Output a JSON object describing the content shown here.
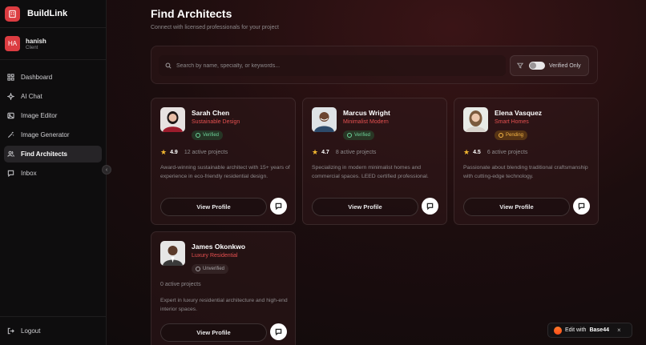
{
  "app": {
    "name": "BuildLink"
  },
  "user": {
    "initials": "HA",
    "name": "hanish",
    "role": "Client"
  },
  "nav": [
    {
      "label": "Dashboard",
      "icon": "grid-icon",
      "active": false
    },
    {
      "label": "AI Chat",
      "icon": "sparkle-icon",
      "active": false
    },
    {
      "label": "Image Editor",
      "icon": "image-icon",
      "active": false
    },
    {
      "label": "Image Generator",
      "icon": "wand-icon",
      "active": false
    },
    {
      "label": "Find Architects",
      "icon": "users-icon",
      "active": true
    },
    {
      "label": "Inbox",
      "icon": "message-icon",
      "active": false
    }
  ],
  "logout": {
    "label": "Logout"
  },
  "page": {
    "title": "Find Architects",
    "subtitle": "Connect with licensed professionals for your project"
  },
  "search": {
    "placeholder": "Search by name, specialty, or keywords...",
    "value": ""
  },
  "filter": {
    "label": "Verified Only",
    "enabled": false
  },
  "architects": [
    {
      "name": "Sarah Chen",
      "specialty": "Sustainable Design",
      "status": "Verified",
      "rating": "4.9",
      "projects": "12 active projects",
      "bio": "Award-winning sustainable architect with 15+ years of experience in eco-friendly residential design.",
      "view_label": "View Profile"
    },
    {
      "name": "Marcus Wright",
      "specialty": "Minimalist Modern",
      "status": "Verified",
      "rating": "4.7",
      "projects": "8 active projects",
      "bio": "Specializing in modern minimalist homes and commercial spaces. LEED certified professional.",
      "view_label": "View Profile"
    },
    {
      "name": "Elena Vasquez",
      "specialty": "Smart Homes",
      "status": "Pending",
      "rating": "4.5",
      "projects": "6 active projects",
      "bio": "Passionate about blending traditional craftsmanship with cutting-edge technology.",
      "view_label": "View Profile"
    },
    {
      "name": "James Okonkwo",
      "specialty": "Luxury Residential",
      "status": "Unverified",
      "rating": "",
      "projects": "0 active projects",
      "bio": "Expert in luxury residential architecture and high-end interior spaces.",
      "view_label": "View Profile"
    }
  ],
  "edit_pill": {
    "prefix": "Edit with",
    "brand": "Base44",
    "close": "×"
  },
  "colors": {
    "accent": "#dc3c41",
    "verified": "#6ed39a",
    "pending": "#f4b545",
    "star": "#f2b730"
  }
}
